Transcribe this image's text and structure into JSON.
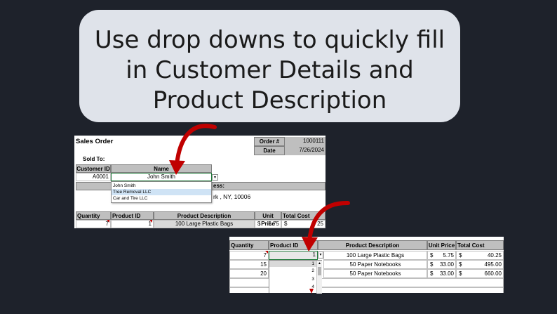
{
  "callout": {
    "lines": [
      "Use drop downs to quickly fill",
      "in Customer Details and",
      "Product Description"
    ]
  },
  "sheet1": {
    "title": "Sales Order",
    "order_label": "Order #",
    "order_value": "1000111",
    "date_label": "Date",
    "date_value": "7/26/2024",
    "sold_to": "Sold To:",
    "customer_id_header": "Customer ID",
    "name_header": "Name",
    "customer_id": "A0001",
    "name_value": "John Smith",
    "address_label_fragment": "ess:",
    "address_fragment": "rk , NY, 10006",
    "dropdown_options": [
      "John Smith",
      "Tree Removal LLC",
      "Car and Tire LLC"
    ],
    "table_headers": [
      "Quantity",
      "Product ID",
      "Product Description",
      "Unit Price",
      "Total Cost"
    ],
    "row": {
      "quantity": "7",
      "product_id": "1",
      "description": "100 Large Plastic Bags",
      "currency": "$",
      "unit_price": "5.75",
      "total_currency": "$",
      "total_fragment": "25"
    }
  },
  "sheet2": {
    "table_headers": [
      "Quantity",
      "Product ID",
      "Product Description",
      "Unit Price",
      "Total Cost"
    ],
    "rows": [
      {
        "quantity": "7",
        "product_id": "1",
        "description": "100 Large Plastic Bags",
        "unit_price": "5.75",
        "total": "40.25"
      },
      {
        "quantity": "15",
        "product_id": "",
        "description": "50 Paper Notebooks",
        "unit_price": "33.00",
        "total": "495.00"
      },
      {
        "quantity": "20",
        "product_id": "",
        "description": "50 Paper Notebooks",
        "unit_price": "33.00",
        "total": "660.00"
      }
    ],
    "currency": "$",
    "dropdown_options": [
      "1",
      "2",
      "3",
      "4"
    ]
  },
  "colors": {
    "background": "#1e222b",
    "arrow": "#c00000",
    "header_gray": "#bfbfbf",
    "callout": "#dfe3ea"
  }
}
